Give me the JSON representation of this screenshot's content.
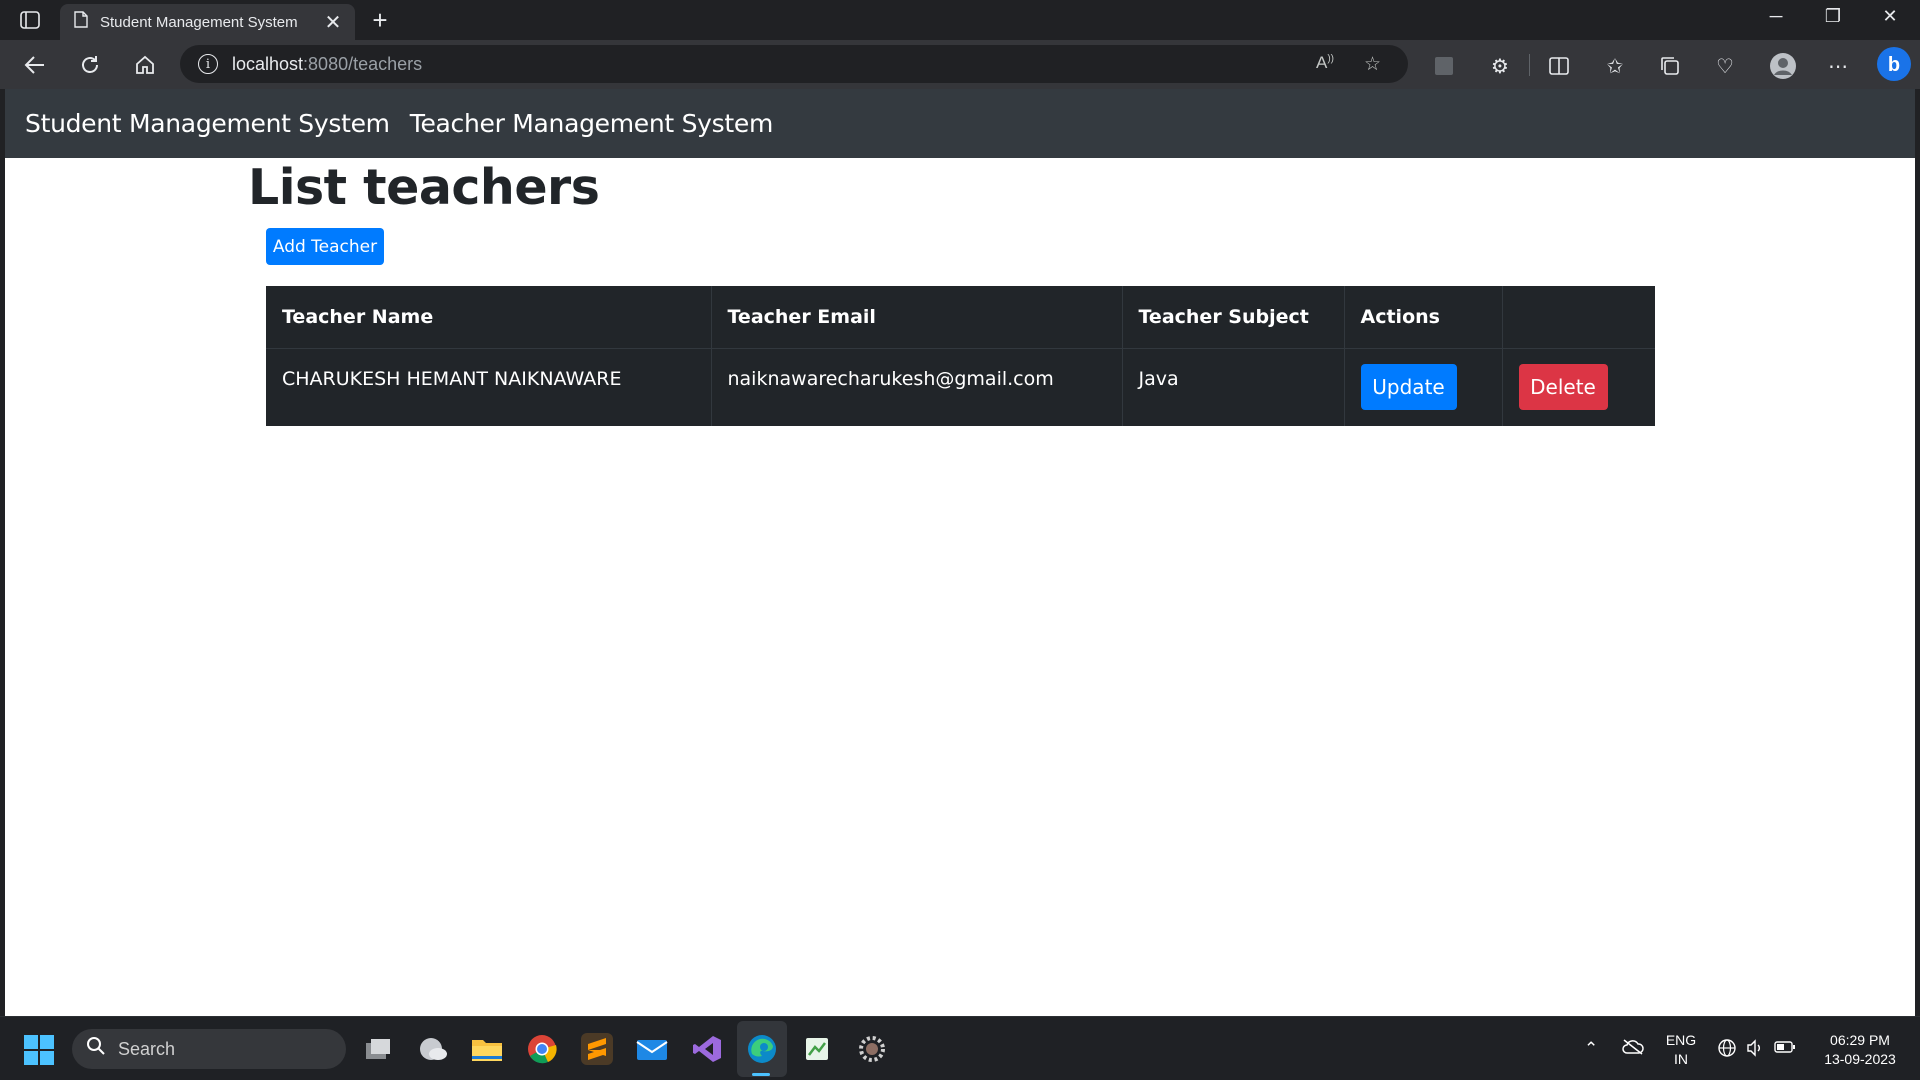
{
  "browser": {
    "tab_title": "Student Management System",
    "tab_close": "✕",
    "new_tab": "+",
    "url_host": "localhost",
    "url_path": ":8080/teachers",
    "window_controls": {
      "minimize": "─",
      "restore": "❐",
      "close": "✕"
    },
    "icons": [
      "back-icon",
      "refresh-icon",
      "home-icon",
      "site-info-icon",
      "read-aloud-icon",
      "favorite-star-icon",
      "extension-icon",
      "extensions-puzzle-icon",
      "split-screen-icon",
      "favorites-icon",
      "collections-icon",
      "browser-essentials-icon",
      "profile-icon",
      "more-menu-icon",
      "copilot-icon"
    ]
  },
  "app": {
    "nav_links": [
      "Student Management System",
      "Teacher Management System"
    ],
    "page_heading": "List teachers",
    "add_button": "Add Teacher",
    "table": {
      "headers": [
        "Teacher Name",
        "Teacher Email",
        "Teacher Subject",
        "Actions",
        ""
      ],
      "rows": [
        {
          "name": "CHARUKESH HEMANT NAIKNAWARE",
          "email": "naiknawarecharukesh@gmail.com",
          "subject": "Java",
          "update_label": "Update",
          "delete_label": "Delete"
        }
      ]
    },
    "colors": {
      "navbar": "#343a40",
      "table_dark": "#212529",
      "primary": "#007bff",
      "danger": "#dc3545"
    }
  },
  "taskbar": {
    "search_placeholder": "Search",
    "language_line1": "ENG",
    "language_line2": "IN",
    "time": "06:29 PM",
    "date": "13-09-2023",
    "apps": [
      "task-view-icon",
      "weather-icon",
      "file-explorer-icon",
      "chrome-icon",
      "sublime-text-icon",
      "mail-icon",
      "visual-studio-icon",
      "edge-icon",
      "notepad-icon",
      "settings-icon"
    ]
  }
}
